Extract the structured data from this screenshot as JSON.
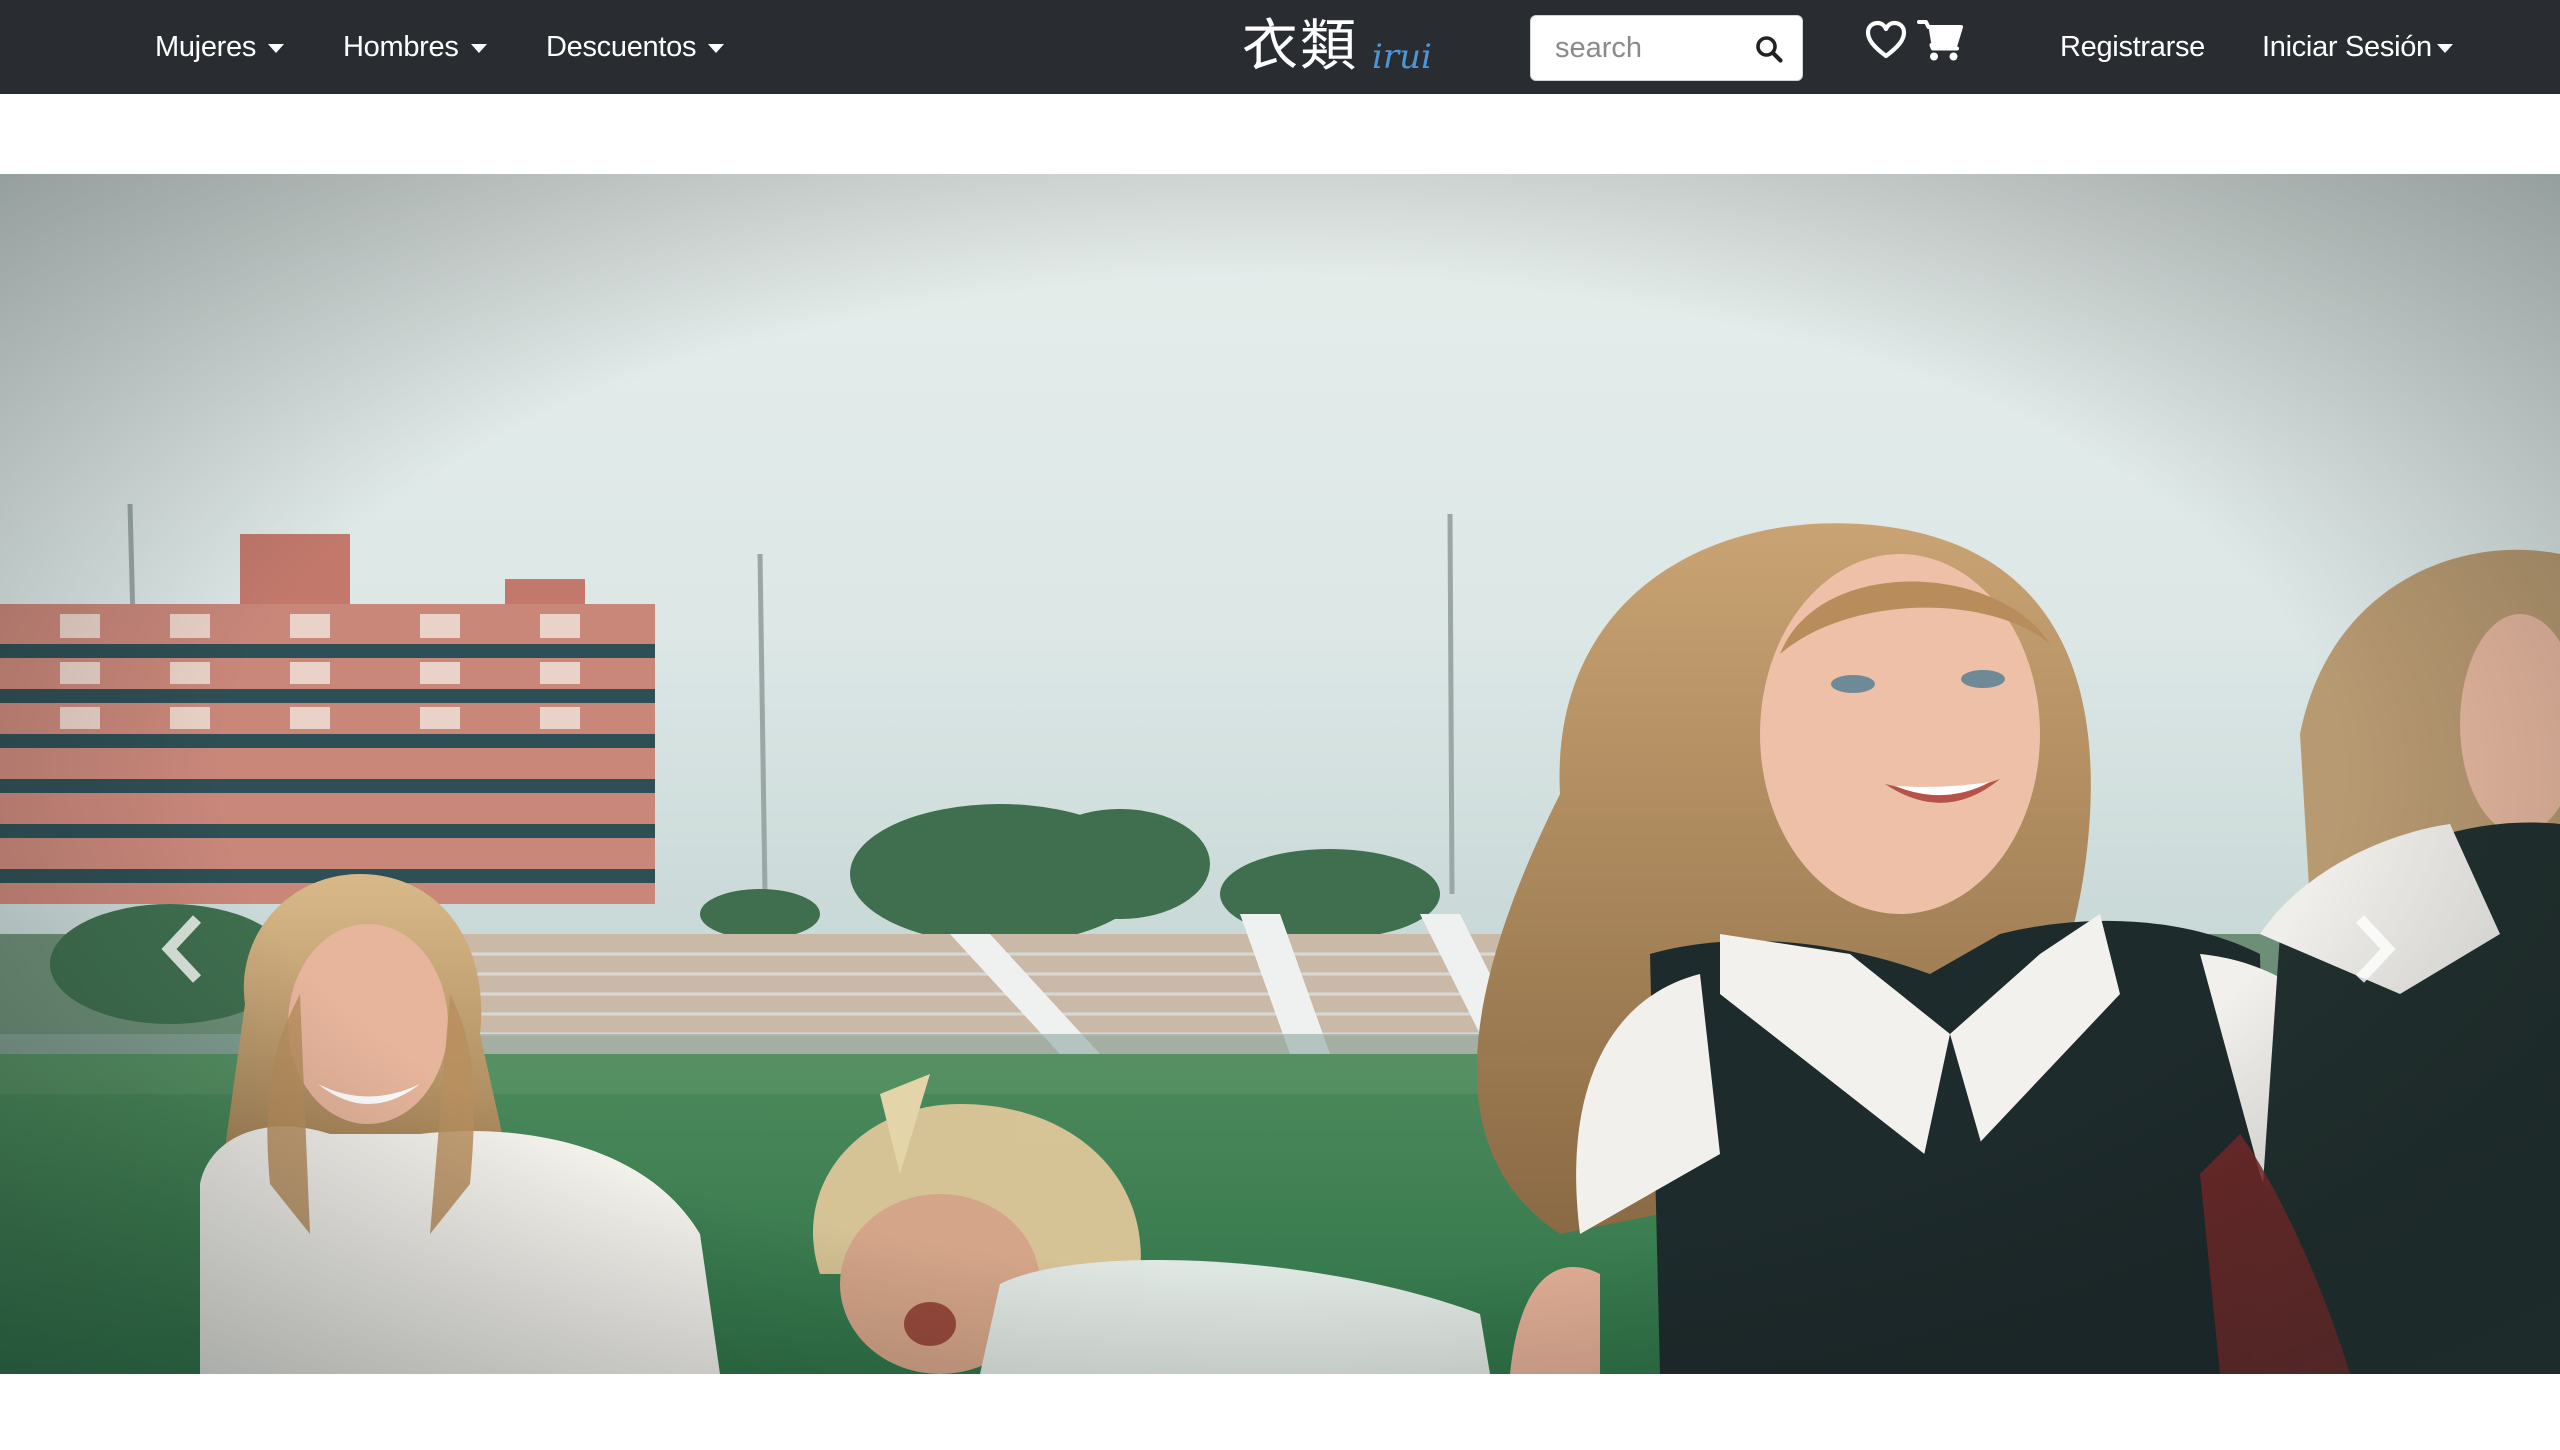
{
  "navbar": {
    "menu": [
      {
        "label": "Mujeres"
      },
      {
        "label": "Hombres"
      },
      {
        "label": "Descuentos"
      }
    ],
    "brand": {
      "kanji": "衣類",
      "roman": "irui"
    },
    "search": {
      "placeholder": "search",
      "value": ""
    },
    "register_label": "Registrarse",
    "login_label": "Iniciar Sesión",
    "icons": {
      "search": "search-icon",
      "wishlist": "heart-icon",
      "cart": "cart-icon"
    }
  },
  "carousel": {
    "slide_count": 4,
    "active_index": 1,
    "prev_icon": "chevron-left-icon",
    "next_icon": "chevron-right-icon"
  },
  "colors": {
    "navbar_bg": "#292d31",
    "brand_accent": "#4e95d6",
    "text_light": "#ffffff"
  }
}
